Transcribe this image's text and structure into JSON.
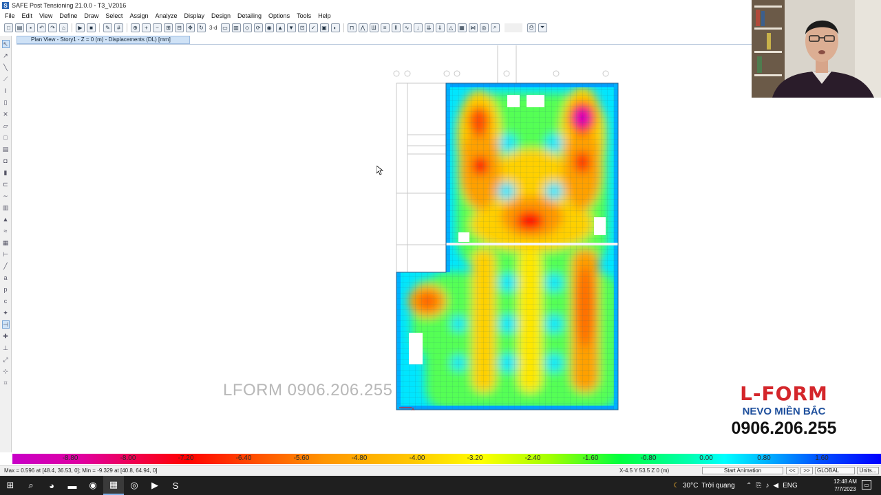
{
  "window": {
    "title": "SAFE Post Tensioning 21.0.0 - T3_V2016",
    "app_icon": "S"
  },
  "menu": [
    "File",
    "Edit",
    "View",
    "Define",
    "Draw",
    "Select",
    "Assign",
    "Analyze",
    "Display",
    "Design",
    "Detailing",
    "Options",
    "Tools",
    "Help"
  ],
  "toolbar": {
    "view_3d_label": "3-d"
  },
  "view_tab": {
    "label": "Plan View - Story1 - Z = 0 (m)  - Displacements (DL)  [mm]"
  },
  "watermark": "LFORM 0906.206.255",
  "brand": {
    "logo": "L-FORM",
    "subtitle": "NEVO MIỀN BẮC",
    "phone": "0906.206.255"
  },
  "legend": {
    "labels": [
      "-8.80",
      "-8.00",
      "-7.20",
      "-6.40",
      "-5.60",
      "-4.80",
      "-4.00",
      "-3.20",
      "-2.40",
      "-1.60",
      "-0.80",
      "0.00",
      "0.80",
      "1.60"
    ]
  },
  "status": {
    "maxmin": "Max = 0.596 at [48.4, 36.53, 0];  Min = -9.329 at [40.8, 64.94, 0]",
    "coords": "X-4.5  Y 53.5  Z 0 (m)",
    "start_animation": "Start Animation",
    "prev": "<<",
    "next": ">>",
    "coord_system": "GLOBAL",
    "units": "Units..."
  },
  "taskbar": {
    "weather_temp": "30°C",
    "weather_text": "Trời quang",
    "language": "ENG",
    "time": "12:48 AM",
    "date": "7/7/2023"
  },
  "colors": {
    "legend_min": "#c800c8",
    "legend_zero": "#00ffff",
    "legend_max": "#0000ff",
    "highlight": "#cfe2f6"
  }
}
